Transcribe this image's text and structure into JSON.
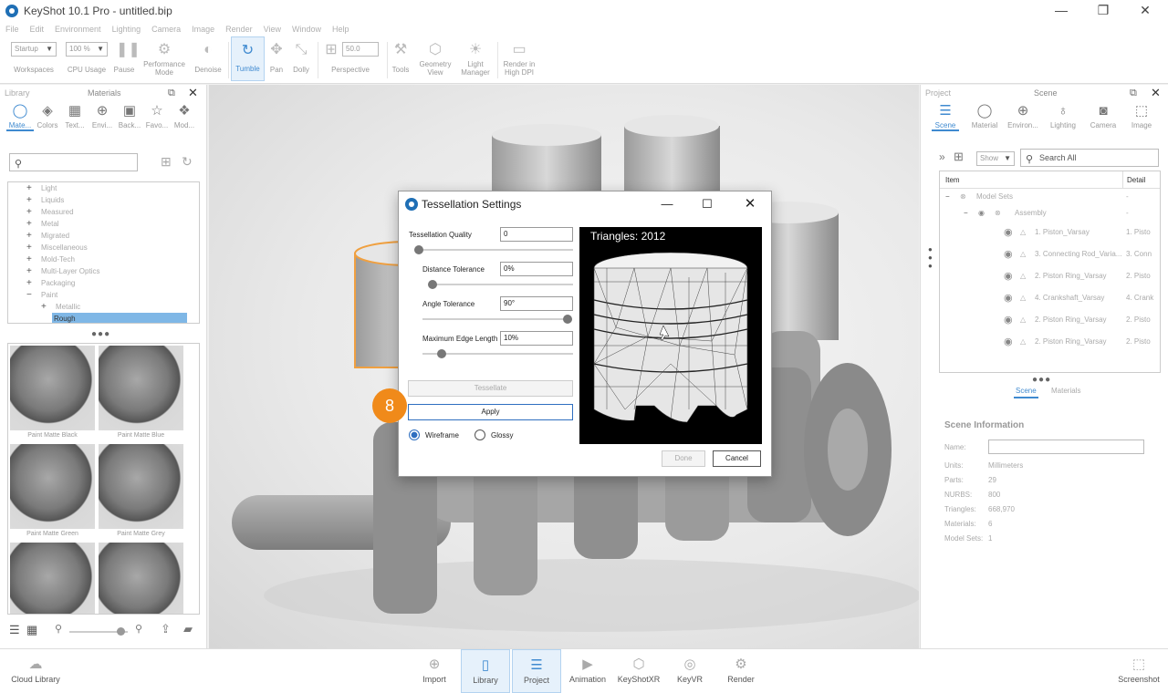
{
  "window": {
    "title": "KeyShot 10.1 Pro  - untitled.bip",
    "controls": {
      "minimize": "—",
      "maximize": "❐",
      "close": "✕"
    }
  },
  "menu": [
    "File",
    "Edit",
    "Environment",
    "Lighting",
    "Camera",
    "Image",
    "Render",
    "View",
    "Window",
    "Help"
  ],
  "toolbar": {
    "workspaces_value": "Startup",
    "workspaces_label": "Workspaces",
    "cpu_value": "100 %",
    "cpu_label": "CPU Usage",
    "pause": "Pause",
    "performance_mode": "Performance Mode",
    "denoise": "Denoise",
    "tumble": "Tumble",
    "pan": "Pan",
    "dolly": "Dolly",
    "perspective_value": "50.0",
    "perspective": "Perspective",
    "tools": "Tools",
    "geometry_view": "Geometry View",
    "light_manager": "Light Manager",
    "render_high_dpi": "Render in High DPI"
  },
  "library": {
    "header": "Library",
    "title": "Materials",
    "tabs": [
      "Mate...",
      "Colors",
      "Text...",
      "Envi...",
      "Back...",
      "Favo...",
      "Mod..."
    ],
    "tree": [
      {
        "label": "Light",
        "pm": "+"
      },
      {
        "label": "Liquids",
        "pm": "+"
      },
      {
        "label": "Measured",
        "pm": "+"
      },
      {
        "label": "Metal",
        "pm": "+"
      },
      {
        "label": "Migrated",
        "pm": "+"
      },
      {
        "label": "Miscellaneous",
        "pm": "+"
      },
      {
        "label": "Mold-Tech",
        "pm": "+"
      },
      {
        "label": "Multi-Layer Optics",
        "pm": "+"
      },
      {
        "label": "Packaging",
        "pm": "+"
      },
      {
        "label": "Paint",
        "pm": "−"
      },
      {
        "label": "Metallic",
        "pm": "+"
      },
      {
        "label": "Rough",
        "pm": ""
      }
    ],
    "thumbs": [
      "Paint Matte Black",
      "Paint Matte Blue",
      "Paint Matte Green",
      "Paint Matte Grey",
      "",
      ""
    ]
  },
  "project": {
    "header": "Project",
    "title": "Scene",
    "tabs": [
      "Scene",
      "Material",
      "Environ...",
      "Lighting",
      "Camera",
      "Image"
    ],
    "show_value": "Show",
    "search_placeholder": "Search All",
    "columns": [
      "Item",
      "Detail"
    ],
    "tree": [
      {
        "name": "Model Sets",
        "detail": "-"
      },
      {
        "name": "Assembly",
        "detail": "-"
      },
      {
        "name": "1. Piston_Varsay",
        "detail": "1. Pisto"
      },
      {
        "name": "3. Connecting Rod_Varia...",
        "detail": "3. Conn"
      },
      {
        "name": "2. Piston Ring_Varsay",
        "detail": "2. Pisto"
      },
      {
        "name": "4. Crankshaft_Varsay",
        "detail": "4. Crank"
      },
      {
        "name": "2. Piston Ring_Varsay",
        "detail": "2. Pisto"
      },
      {
        "name": "2. Piston Ring_Varsay",
        "detail": "2. Pisto"
      }
    ],
    "bottom_tabs": [
      "Scene",
      "Materials"
    ],
    "scene_info_title": "Scene Information",
    "info": {
      "name_label": "Name:",
      "units_label": "Units:",
      "units": "Millimeters",
      "parts_label": "Parts:",
      "parts": "29",
      "nurbs_label": "NURBS:",
      "nurbs": "800",
      "triangles_label": "Triangles:",
      "triangles": "668,970",
      "materials_label": "Materials:",
      "materials": "6",
      "model_sets_label": "Model Sets:",
      "model_sets": "1"
    }
  },
  "dialog": {
    "title": "Tessellation Settings",
    "quality_label": "Tessellation Quality",
    "quality_value": "0",
    "quality_level": 0,
    "distance_label": "Distance Tolerance",
    "distance_value": "0%",
    "distance_level": 0,
    "angle_label": "Angle Tolerance",
    "angle_value": "90°",
    "angle_level": 1,
    "edge_label": "Maximum Edge Length",
    "edge_value": "10%",
    "edge_level": 0.1,
    "tessellate_button": "Tessellate",
    "apply_button": "Apply",
    "wireframe_label": "Wireframe",
    "glossy_label": "Glossy",
    "triangles_text": "Triangles: 2012",
    "done_button": "Done",
    "cancel_button": "Cancel"
  },
  "step_badge": "8",
  "bottombar": {
    "cloud_library": "Cloud Library",
    "import": "Import",
    "library": "Library",
    "project": "Project",
    "animation": "Animation",
    "keyshotxr": "KeyShotXR",
    "keyvr": "KeyVR",
    "render": "Render",
    "screenshot": "Screenshot"
  },
  "colors": {
    "accent": "#3f8ad0",
    "badge": "#f08a1a",
    "dialog_border": "#9a9a9a"
  }
}
